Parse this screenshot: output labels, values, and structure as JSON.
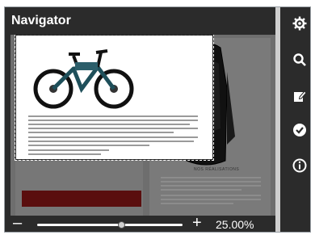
{
  "panel": {
    "title": "Navigator"
  },
  "zoom": {
    "value_label": "25.00%",
    "slider_fraction": 0.58,
    "minus_label": "–",
    "plus_label": "+"
  },
  "preview": {
    "left_page_caption": "",
    "right_page_caption": "NOS RÉALISATIONS",
    "red_block_color": "#5a0e0e"
  },
  "sidebar": {
    "items": [
      {
        "icon": "settings-gear-icon"
      },
      {
        "icon": "search-icon"
      },
      {
        "icon": "edit-icon"
      },
      {
        "icon": "check-circle-icon"
      },
      {
        "icon": "info-icon"
      }
    ]
  }
}
